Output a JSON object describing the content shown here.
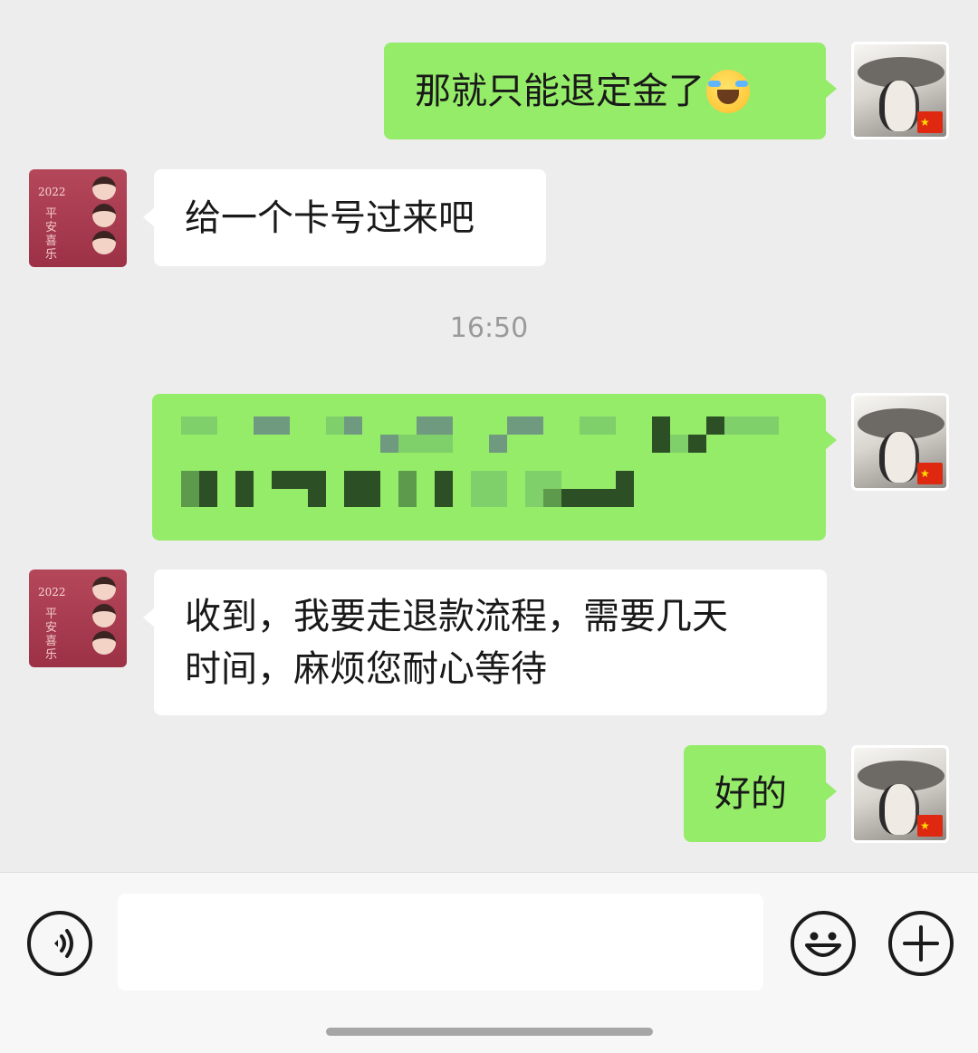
{
  "messages": [
    {
      "sender": "me",
      "text": "那就只能退定金了",
      "emoji": "laughing-crying-emoji"
    },
    {
      "sender": "them",
      "text": "给一个卡号过来吧"
    },
    {
      "timestamp": "16:50"
    },
    {
      "sender": "me",
      "content": "pixelated-redacted-card-number"
    },
    {
      "sender": "them",
      "lines": [
        "收到，我要走退款流程，需要几天",
        "时间，麻烦您耐心等待"
      ]
    },
    {
      "sender": "me",
      "text": "好的"
    }
  ],
  "avatars": {
    "me": {
      "badge": "china-flag"
    },
    "them": {
      "year": "2022",
      "caption": "平安喜乐"
    }
  },
  "input_bar": {
    "placeholder": "",
    "icons": [
      "voice-icon",
      "emoji-face-icon",
      "plus-icon"
    ]
  },
  "colors": {
    "background": "#ededed",
    "outgoing_bubble": "#95ec69",
    "incoming_bubble": "#ffffff",
    "timestamp_text": "#9a9a9a"
  }
}
